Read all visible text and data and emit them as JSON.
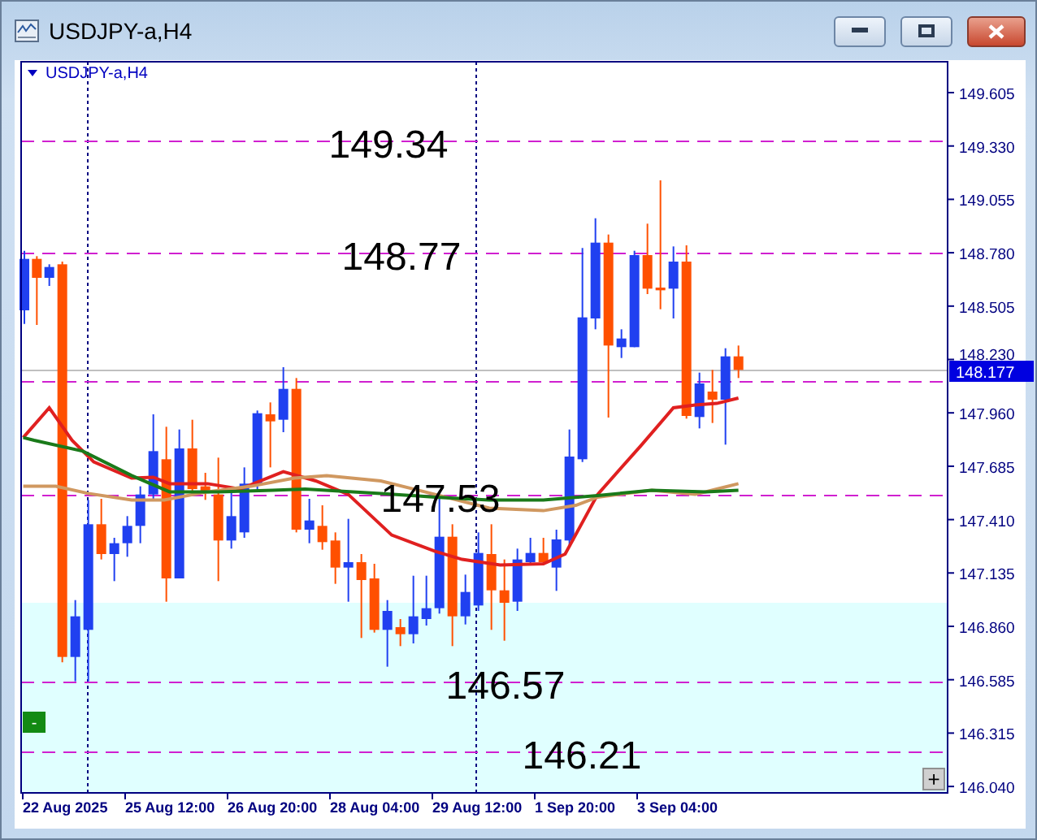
{
  "window": {
    "title": "USDJPY-a,H4"
  },
  "chart": {
    "symbol_label": "USDJPY-a,H4",
    "levels": [
      {
        "kind": "labeled",
        "label": "149.34"
      },
      {
        "kind": "labeled",
        "label": "148.77"
      },
      {
        "kind": "plain"
      },
      {
        "kind": "labeled",
        "label": "147.53"
      },
      {
        "kind": "labeled",
        "label": "146.57"
      },
      {
        "kind": "labeled",
        "label": "146.21"
      }
    ],
    "price_axis": [
      "149.605",
      "149.330",
      "149.055",
      "148.780",
      "148.505",
      "148.230",
      "147.960",
      "147.685",
      "147.410",
      "147.135",
      "146.860",
      "146.585",
      "146.315",
      "146.040"
    ],
    "current_price": "148.177",
    "time_axis": [
      "22 Aug 2025",
      "25 Aug 12:00",
      "26 Aug 20:00",
      "28 Aug 04:00",
      "29 Aug 12:00",
      "1 Sep 20:00",
      "3 Sep 04:00"
    ],
    "collapse_button": "-",
    "zoom_button": "+"
  }
}
